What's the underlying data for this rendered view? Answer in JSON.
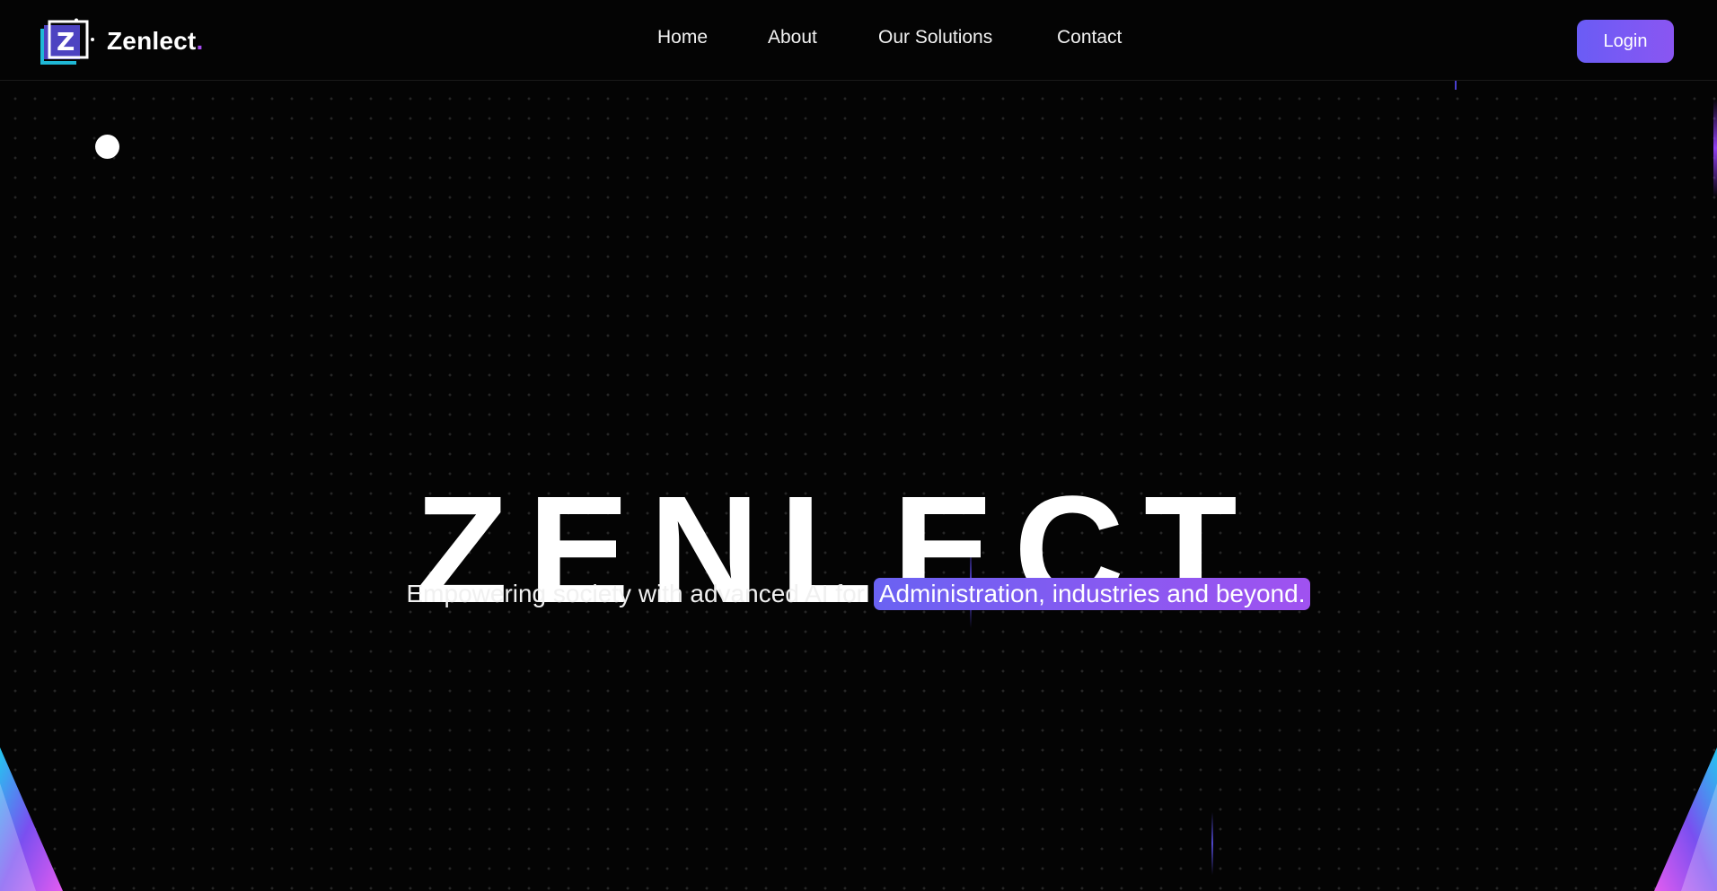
{
  "navbar": {
    "brand_name": "Zenlect",
    "brand_dot": ".",
    "links": [
      {
        "label": "Home"
      },
      {
        "label": "About"
      },
      {
        "label": "Our Solutions"
      },
      {
        "label": "Contact"
      }
    ],
    "login_label": "Login"
  },
  "hero": {
    "title": "ZENLECT.",
    "subtitle": "Empowering society with advanced AI for",
    "highlight": "Administration, industries and beyond."
  },
  "colors": {
    "background": "#040404",
    "accent_start": "#6a5cf5",
    "accent_end": "#a052f0",
    "logo_cyan": "#1fb8d6",
    "logo_purple": "#5b4fe3"
  },
  "icons": {
    "logo": "zenlect-logo-icon",
    "decor_dot": "glow-dot",
    "corner_left": "prism-left-decor",
    "corner_right": "prism-right-decor"
  }
}
